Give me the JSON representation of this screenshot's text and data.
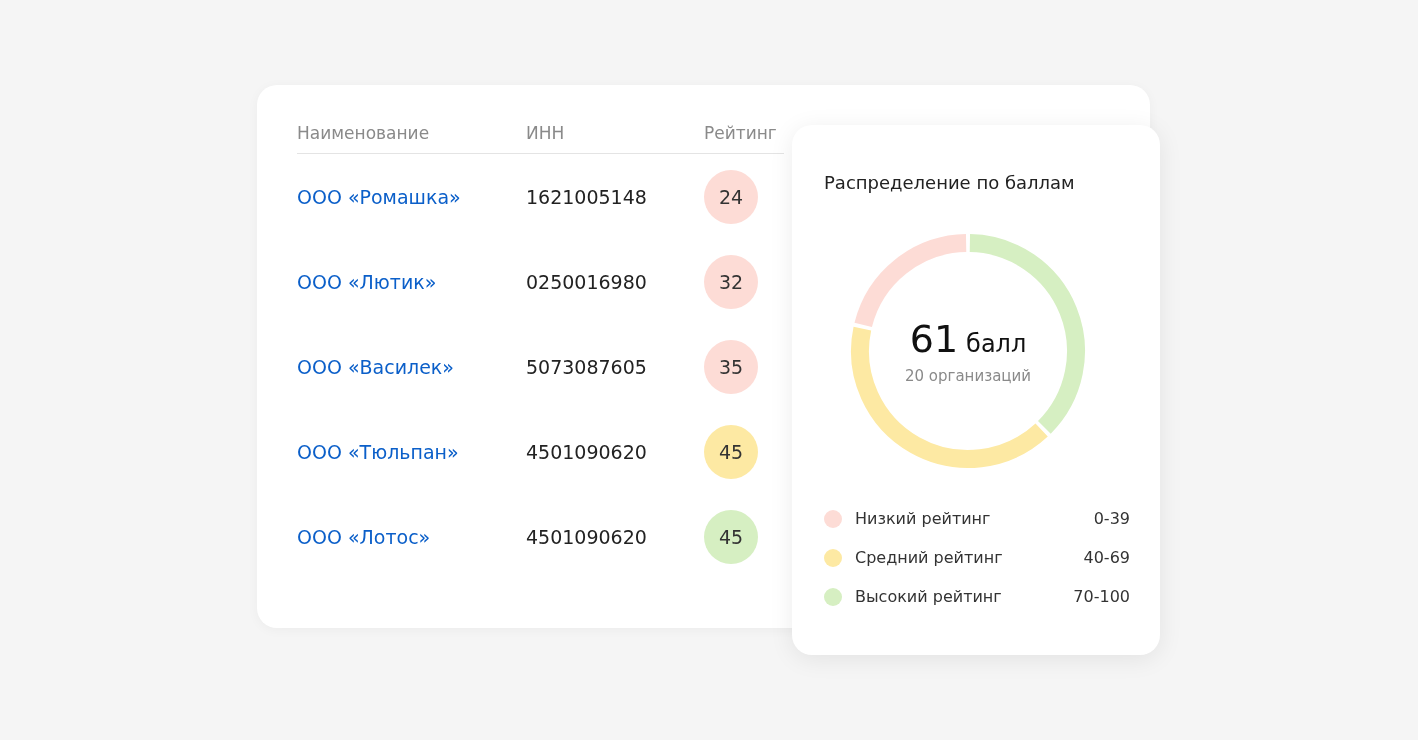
{
  "table": {
    "columns": [
      "Наименование",
      "ИНН",
      "Рейтинг"
    ],
    "rows": [
      {
        "name": "ООО «Ромашка»",
        "inn": "1621005148",
        "rating": "24",
        "color": "#fddcd6"
      },
      {
        "name": "ООО «Лютик»",
        "inn": "0250016980",
        "rating": "32",
        "color": "#fddcd6"
      },
      {
        "name": "ООО «Василек»",
        "inn": "5073087605",
        "rating": "35",
        "color": "#fddcd6"
      },
      {
        "name": "ООО «Тюльпан»",
        "inn": "4501090620",
        "rating": "45",
        "color": "#fde9a3"
      },
      {
        "name": "ООО «Лотос»",
        "inn": "4501090620",
        "rating": "45",
        "color": "#d6efc2"
      }
    ]
  },
  "distribution": {
    "title": "Распределение по баллам",
    "score": "61",
    "unit": "балл",
    "subtitle": "20 организаций",
    "legend": [
      {
        "label": "Низкий рейтинг",
        "range": "0-39",
        "color": "#fddcd6"
      },
      {
        "label": "Средний рейтинг",
        "range": "40-69",
        "color": "#fde9a3"
      },
      {
        "label": "Высокий рейтинг",
        "range": "70-100",
        "color": "#d6efc2"
      }
    ]
  }
}
